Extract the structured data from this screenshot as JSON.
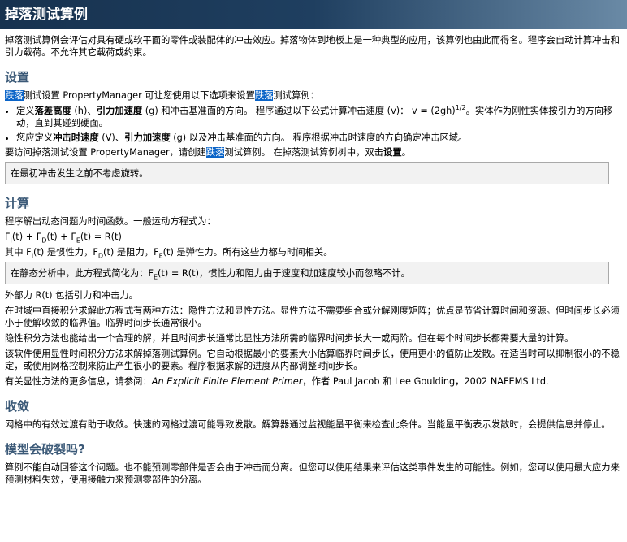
{
  "page": {
    "title": "掉落测试算例"
  },
  "intro": "掉落测试算例会评估对具有硬或软平面的零件或装配体的冲击效应。掉落物体到地板上是一种典型的应用，该算例也由此而得名。程序会自动计算冲击和引力载荷。不允许其它载荷或约束。",
  "setup": {
    "heading": "设置",
    "lead": {
      "hl1": "跌落",
      "t1": "测试设置 PropertyManager 可让您使用以下选项来设置",
      "hl2": "跌落",
      "t2": "测试算例："
    },
    "bullet1": {
      "t1": "定义",
      "b1": "落差高度",
      "t2": " (h)、",
      "b2": "引力加速度",
      "t3": " (g) 和冲击基准面的方向。 程序通过以下公式计算冲击速度 (v)：  v = (2gh)",
      "sup": "1/2",
      "t4": "。实体作为刚性实体按引力的方向移动，直到其碰到硬面。"
    },
    "bullet2": {
      "t1": "您应定义",
      "b1": "冲击时速度",
      "t2": " (V)、",
      "b2": "引力加速度",
      "t3": " (g) 以及冲击基准面的方向。 程序根据冲击时速度的方向确定冲击区域。"
    },
    "access": {
      "t1": "要访问掉落测试设置 PropertyManager，请创建",
      "hl": "跌落",
      "t2": "测试算例。 在掉落测试算例树中，双击",
      "b": "设置",
      "t3": "。"
    },
    "note": "在最初冲击发生之前不考虑旋转。"
  },
  "calc": {
    "heading": "计算",
    "p1": "程序解出动态问题为时间函数。一般运动方程式为：",
    "eq": {
      "f": "F",
      "s1": "I",
      "m1": "(t) + F",
      "s2": "D",
      "m2": "(t) + F",
      "s3": "E",
      "m3": "(t) = R(t)"
    },
    "p2": {
      "t1": "其中 F",
      "s1": "I",
      "t2": "(t) 是惯性力，F",
      "s2": "D",
      "t3": "(t) 是阻力，F",
      "s3": "E",
      "t4": "(t) 是弹性力。所有这些力都与时间相关。"
    },
    "note": {
      "t1": "在静态分析中，此方程式简化为：F",
      "s": "E",
      "t2": "(t) = R(t)，惯性力和阻力由于速度和加速度较小而忽略不计。"
    },
    "p3": "外部力 R(t) 包括引力和冲击力。",
    "p4": "在时域中直接积分求解此方程式有两种方法：隐性方法和显性方法。显性方法不需要组合或分解刚度矩阵；优点是节省计算时间和资源。但时间步长必须小于使解收敛的临界值。临界时间步长通常很小。",
    "p5": "隐性积分方法也能给出一个合理的解，并且时间步长通常比显性方法所需的临界时间步长大一或两阶。但在每个时间步长都需要大量的计算。",
    "p6": "该软件使用显性时间积分方法求解掉落测试算例。它自动根据最小的要素大小估算临界时间步长，使用更小的值防止发散。在适当时可以抑制很小的不稳定，或使用网格控制来防止产生很小的要素。程序根据求解的进度从内部调整时间步长。",
    "p7": {
      "t1": "有关显性方法的更多信息，请参阅：",
      "em": "An Explicit Finite Element Primer",
      "t2": "，作者 Paul Jacob 和 Lee Goulding，2002 NAFEMS Ltd."
    }
  },
  "convergence": {
    "heading": "收敛",
    "p1": "网格中的有效过渡有助于收敛。快速的网格过渡可能导致发散。解算器通过监视能量平衡来检查此条件。当能量平衡表示发散时，会提供信息并停止。"
  },
  "fracture": {
    "heading": "模型会破裂吗?",
    "p1": "算例不能自动回答这个问题。也不能预测零部件是否会由于冲击而分离。但您可以使用结果来评估这类事件发生的可能性。例如，您可以使用最大应力来预测材料失效，使用接触力来预测零部件的分离。"
  },
  "colors": {
    "title_bg": "#1f3f60",
    "heading": "#3c5a78",
    "highlight": "#0a64c8"
  }
}
